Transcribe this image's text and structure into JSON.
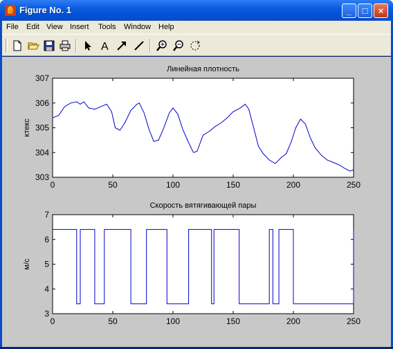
{
  "window": {
    "title": "Figure No. 1"
  },
  "menu": [
    "File",
    "Edit",
    "View",
    "Insert",
    "Tools",
    "Window",
    "Help"
  ],
  "toolbar": [
    "new-icon",
    "open-icon",
    "save-icon",
    "print-icon",
    "pointer-icon",
    "text-icon",
    "arrow-icon",
    "line-icon",
    "zoom-in-icon",
    "zoom-out-icon",
    "rotate-icon"
  ],
  "chart_data": [
    {
      "type": "line",
      "title": "Линейная плотность",
      "xlabel": "",
      "ylabel": "ктекс",
      "xlim": [
        0,
        250
      ],
      "ylim": [
        303,
        307
      ],
      "xticks": [
        0,
        50,
        100,
        150,
        200,
        250
      ],
      "yticks": [
        303,
        304,
        305,
        306,
        307
      ],
      "color": "#0000c8",
      "x": [
        0,
        5,
        10,
        15,
        20,
        23,
        26,
        30,
        35,
        40,
        45,
        49,
        52,
        56,
        60,
        65,
        70,
        72,
        76,
        80,
        84,
        88,
        92,
        97,
        100,
        104,
        108,
        113,
        117,
        120,
        125,
        130,
        135,
        140,
        145,
        150,
        156,
        160,
        163,
        167,
        171,
        175,
        180,
        185,
        190,
        194,
        198,
        202,
        206,
        210,
        214,
        218,
        223,
        228,
        233,
        238,
        243,
        247,
        250
      ],
      "y": [
        305.4,
        305.5,
        305.85,
        306.0,
        306.05,
        305.95,
        306.05,
        305.8,
        305.75,
        305.85,
        305.95,
        305.65,
        305.0,
        304.9,
        305.2,
        305.7,
        305.95,
        306.0,
        305.6,
        304.95,
        304.45,
        304.5,
        304.95,
        305.6,
        305.8,
        305.55,
        304.95,
        304.4,
        304.0,
        304.05,
        304.7,
        304.85,
        305.05,
        305.2,
        305.4,
        305.65,
        305.8,
        305.95,
        305.75,
        305.0,
        304.25,
        303.95,
        303.7,
        303.55,
        303.8,
        303.95,
        304.4,
        305.0,
        305.35,
        305.15,
        304.6,
        304.2,
        303.9,
        303.7,
        303.6,
        303.5,
        303.35,
        303.25,
        303.3
      ]
    },
    {
      "type": "line",
      "title": "Скорость вятягивающей пары",
      "xlabel": "",
      "ylabel": "м/с",
      "xlim": [
        0,
        250
      ],
      "ylim": [
        3,
        7
      ],
      "xticks": [
        0,
        50,
        100,
        150,
        200,
        250
      ],
      "yticks": [
        3,
        4,
        5,
        6,
        7
      ],
      "color": "#0000c8",
      "x": [
        0,
        20,
        20,
        23,
        23,
        35,
        35,
        43,
        43,
        65,
        65,
        78,
        78,
        95,
        95,
        113,
        113,
        132,
        132,
        134,
        134,
        155,
        155,
        180,
        180,
        183,
        183,
        188,
        188,
        200,
        200,
        250,
        250
      ],
      "y": [
        6.4,
        6.4,
        3.4,
        3.4,
        6.4,
        6.4,
        3.4,
        3.4,
        6.4,
        6.4,
        3.4,
        3.4,
        6.4,
        6.4,
        3.4,
        3.4,
        6.4,
        6.4,
        3.4,
        3.4,
        6.4,
        6.4,
        3.4,
        3.4,
        6.4,
        6.4,
        3.4,
        3.4,
        6.4,
        6.4,
        3.4,
        3.4,
        6.4
      ]
    }
  ]
}
